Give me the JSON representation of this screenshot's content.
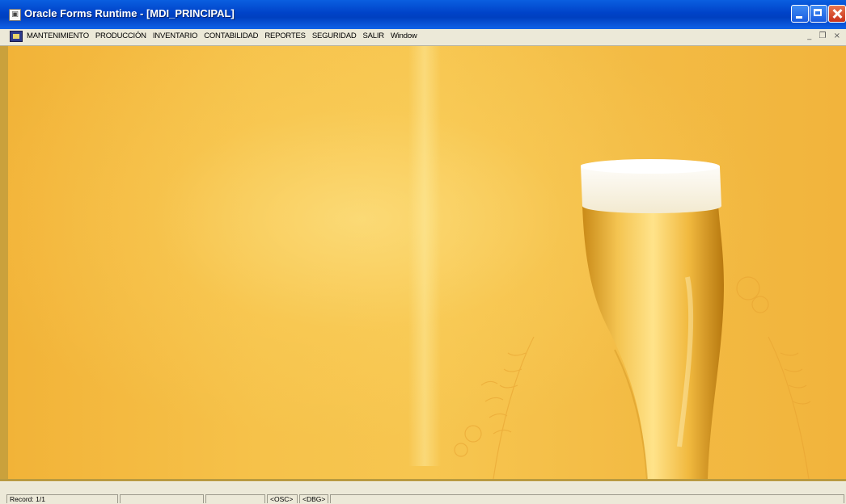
{
  "window": {
    "title": "Oracle Forms Runtime - [MDI_PRINCIPAL]",
    "icon": "oracle-forms-icon"
  },
  "menubar": {
    "items": [
      {
        "label": "MANTENIMIENTO"
      },
      {
        "label": "PRODUCCIÓN"
      },
      {
        "label": "INVENTARIO"
      },
      {
        "label": "CONTABILIDAD"
      },
      {
        "label": "REPORTES"
      },
      {
        "label": "SEGURIDAD"
      },
      {
        "label": "SALIR"
      },
      {
        "label": "Window"
      }
    ],
    "mdi_controls": "_ ❐ ×"
  },
  "statusbar": {
    "record": "Record: 1/1",
    "panel2": "",
    "panel3": "",
    "osc": "<OSC>",
    "dbg": "<DBG>"
  },
  "colors": {
    "titlebar": "#0042c8",
    "background": "#f6c24a",
    "chrome": "#ece9d8"
  }
}
